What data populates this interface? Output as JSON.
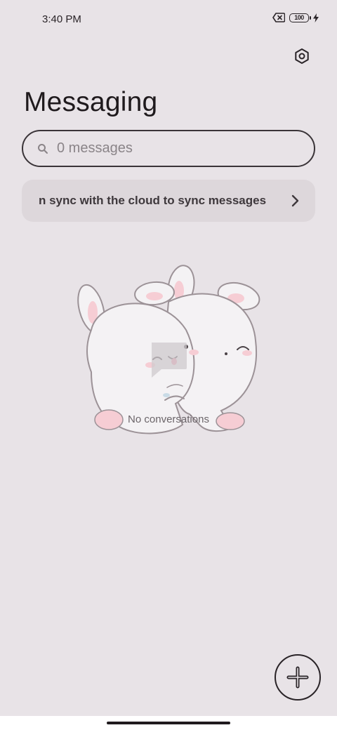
{
  "status_bar": {
    "time": "3:40 PM",
    "battery_level": "100"
  },
  "header": {
    "title": "Messaging",
    "settings_icon": "gear-hex-icon"
  },
  "search": {
    "text": "0 messages",
    "icon": "search-icon"
  },
  "sync_banner": {
    "text": "n sync with the cloud to sync messages",
    "icon": "chevron-right-icon"
  },
  "empty_state": {
    "label": "No conversations",
    "illustration": "bunnies-hugging",
    "icon": "message-bubble-icon"
  },
  "fab": {
    "icon": "plus-icon"
  },
  "colors": {
    "background": "#e8e3e7",
    "banner": "#ddd7db",
    "text": "#2a2428",
    "accent_pink": "#f3c7cf"
  }
}
